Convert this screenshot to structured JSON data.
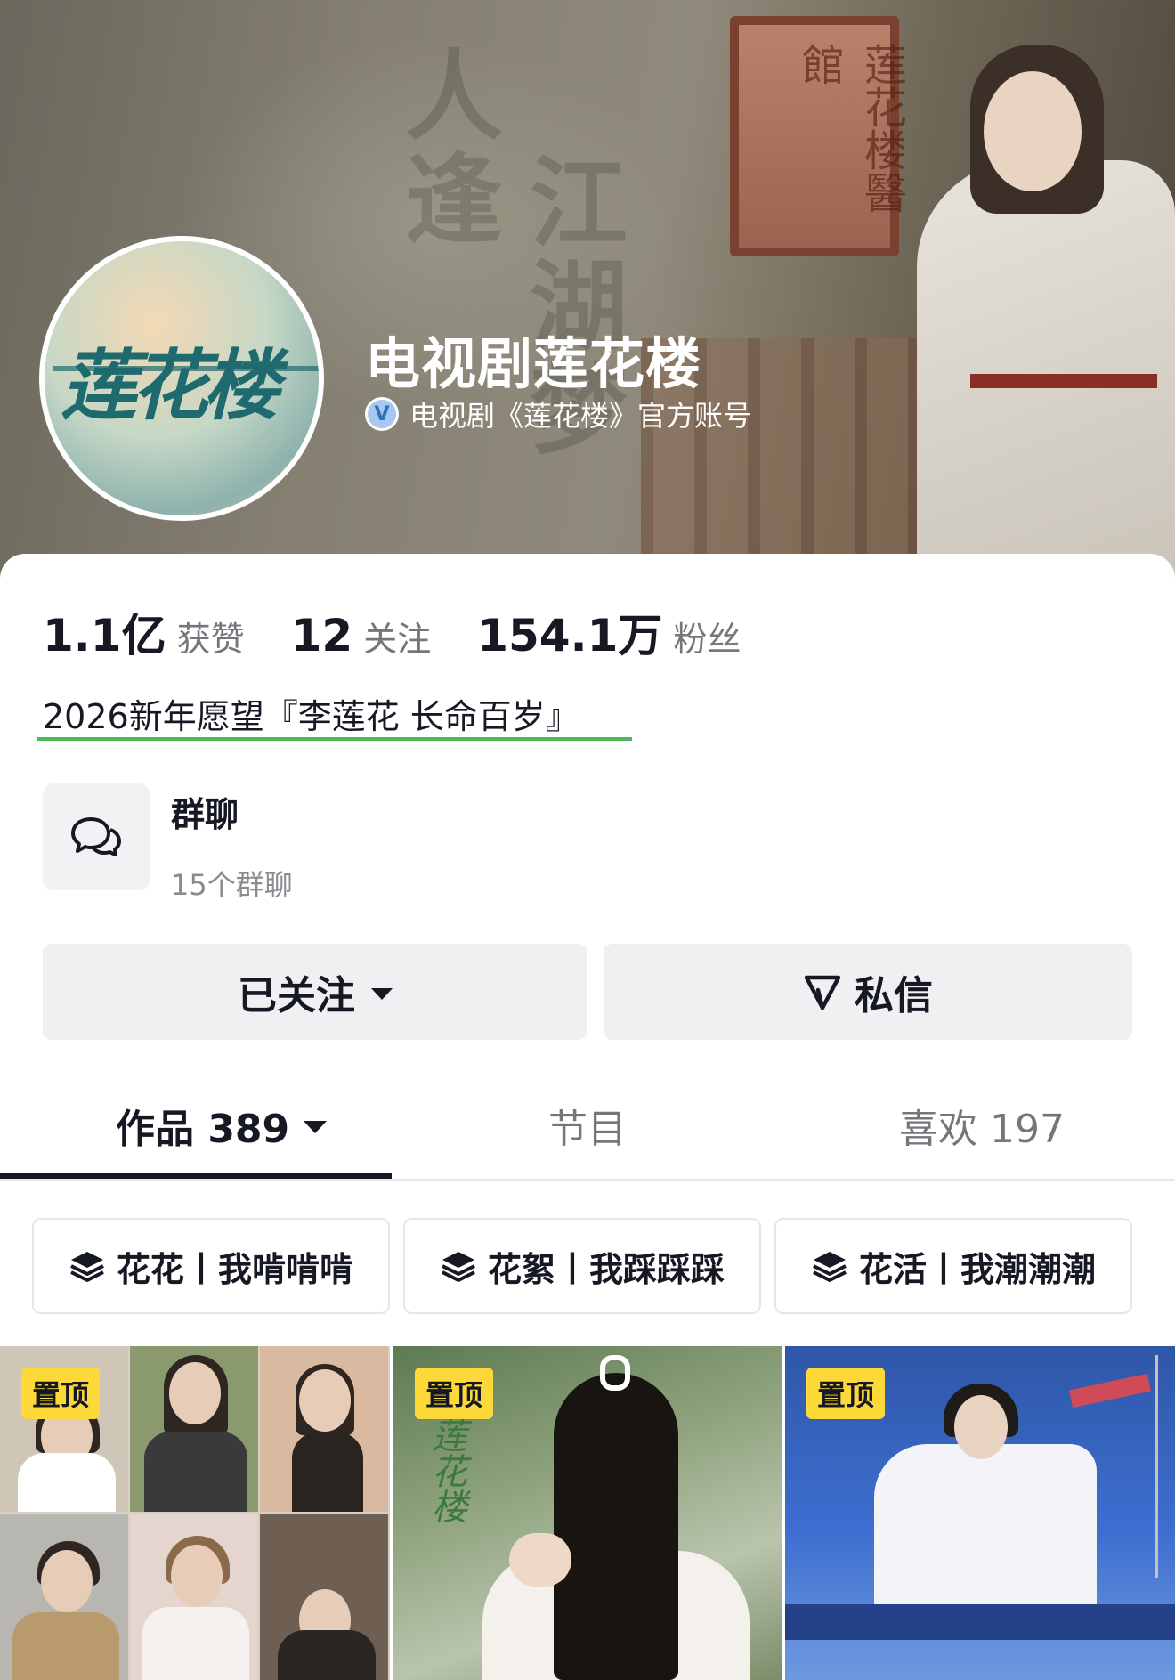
{
  "profile": {
    "name": "电视剧莲花楼",
    "verified_text": "电视剧《莲花楼》官方账号",
    "avatar_text": "莲花楼",
    "banner_calligraphy_1": "人逢",
    "banner_calligraphy_2": "江湖梦",
    "banner_sign": "莲花楼醫館"
  },
  "stats": [
    {
      "value": "1.1亿",
      "label": "获赞"
    },
    {
      "value": "12",
      "label": "关注"
    },
    {
      "value": "154.1万",
      "label": "粉丝"
    }
  ],
  "bio": "2026新年愿望『李莲花 长命百岁』",
  "group_chat": {
    "title": "群聊",
    "subtitle": "15个群聊",
    "icon": "chat-bubbles-icon"
  },
  "actions": {
    "follow_label": "已关注",
    "message_label": "私信"
  },
  "tabs": [
    {
      "label": "作品 389",
      "active": true
    },
    {
      "label": "节目",
      "active": false
    },
    {
      "label": "喜欢 197",
      "active": false
    }
  ],
  "collections": [
    {
      "label": "花花丨我啃啃啃",
      "icon": "layers-icon"
    },
    {
      "label": "花絮丨我踩踩踩",
      "icon": "layers-icon"
    },
    {
      "label": "花活丨我潮潮潮",
      "icon": "layers-icon"
    }
  ],
  "thumbnails": [
    {
      "badge": "置顶"
    },
    {
      "badge": "置顶"
    },
    {
      "badge": "置顶"
    }
  ],
  "colors": {
    "pin_badge": "#fcd938",
    "bio_underline": "#4cb85a",
    "verify_badge": "#a6c8ef"
  }
}
